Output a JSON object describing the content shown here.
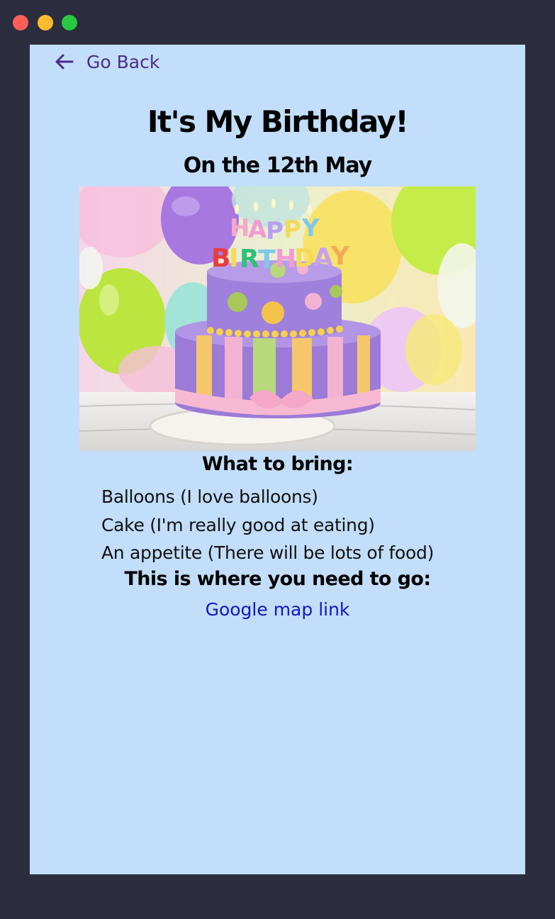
{
  "window": {
    "controls": [
      "close",
      "minimize",
      "maximize"
    ],
    "colors": {
      "close": "#ff5f57",
      "minimize": "#febc2e",
      "maximize": "#28c840",
      "frame": "#2b2d3e"
    }
  },
  "page": {
    "background": "#c2defa",
    "back": {
      "label": "Go Back",
      "icon": "arrow-left-icon",
      "color": "#4b2a8c"
    },
    "title": "It's My Birthday!",
    "subtitle": "On the 12th May",
    "photo": {
      "candles_text": [
        "HAPPY",
        "BIRTHDAY"
      ]
    },
    "bring": {
      "heading": "What to bring:",
      "items": [
        "Balloons (I love balloons)",
        "Cake (I'm really good at eating)",
        "An appetite (There will be lots of food)"
      ]
    },
    "where": {
      "heading": "This is where you need to go:",
      "link_label": "Google map link",
      "link_color": "#1414c8"
    }
  }
}
